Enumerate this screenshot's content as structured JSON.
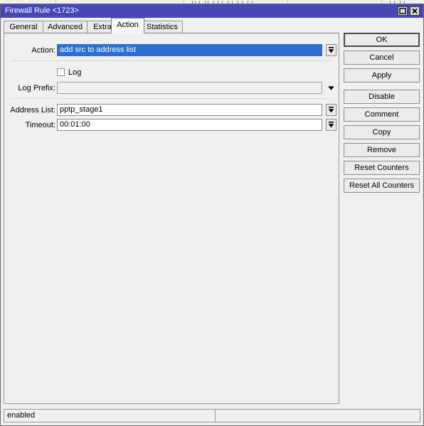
{
  "background_window": {
    "visible_sliver": true
  },
  "dialog": {
    "title": "Firewall Rule <1723>",
    "title_controls": [
      {
        "name": "maximize",
        "glyph": "maximize-icon"
      },
      {
        "name": "close",
        "glyph": "close-icon"
      }
    ],
    "colors": {
      "titlebar": "#4648b8",
      "titlebar_text": "#ffffff",
      "face": "#f0f0f0",
      "selection": "#2c6fd0",
      "field_background": "#ffffff",
      "border": "#8c8c8c"
    }
  },
  "tabs": [
    {
      "label": "General",
      "active": false
    },
    {
      "label": "Advanced",
      "active": false
    },
    {
      "label": "Extra",
      "active": false
    },
    {
      "label": "Action",
      "active": true
    },
    {
      "label": "Statistics",
      "active": false
    }
  ],
  "form": {
    "action": {
      "label": "Action:",
      "value": "add src to address list",
      "selected": true,
      "control": "combo-spinner"
    },
    "log": {
      "label": "Log",
      "checked": false
    },
    "log_prefix": {
      "label": "Log Prefix:",
      "value": "",
      "placeholder": "",
      "readonly": true,
      "control": "dropdown-arrow"
    },
    "address_list": {
      "label": "Address List:",
      "value": "pptp_stage1",
      "control": "combo-spinner"
    },
    "timeout": {
      "label": "Timeout:",
      "value": "00:01:00",
      "control": "combo-spinner"
    }
  },
  "buttons": [
    {
      "label": "OK",
      "focus": true
    },
    {
      "label": "Cancel",
      "focus": false
    },
    {
      "label": "Apply",
      "focus": false
    },
    {
      "label": "Disable",
      "focus": false
    },
    {
      "label": "Comment",
      "focus": false
    },
    {
      "label": "Copy",
      "focus": false
    },
    {
      "label": "Remove",
      "focus": false
    },
    {
      "label": "Reset Counters",
      "focus": false
    },
    {
      "label": "Reset All Counters",
      "focus": false
    }
  ],
  "statusbar": {
    "left": "enabled",
    "right": ""
  }
}
